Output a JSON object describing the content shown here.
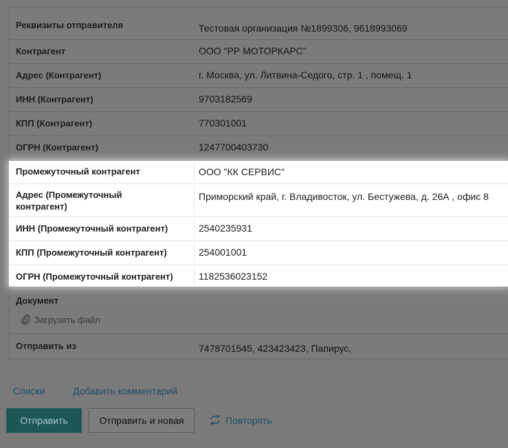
{
  "rows": [
    {
      "label": "Реквизиты отправителя",
      "value": "Тестовая организация №1899306, 9618993069"
    },
    {
      "label": "Контрагент",
      "value": "ООО \"РР МОТОРКАРС\""
    },
    {
      "label": "Адрес (Контрагент)",
      "value": "г. Москва, ул. Литвина-Седого, стр. 1 , помещ. 1"
    },
    {
      "label": "ИНН (Контрагент)",
      "value": "9703182569"
    },
    {
      "label": "КПП (Контрагент)",
      "value": "770301001"
    },
    {
      "label": "ОГРН (Контрагент)",
      "value": "1247700403730"
    },
    {
      "label": "Промежуточный контрагент",
      "value": "ООО \"КК СЕРВИС\""
    },
    {
      "label": "Адрес (Промежуточный контрагент)",
      "value": "Приморский край, г. Владивосток, ул. Бестужева, д. 26А , офис 8"
    },
    {
      "label": "ИНН (Промежуточный контрагент)",
      "value": "2540235931"
    },
    {
      "label": "КПП (Промежуточный контрагент)",
      "value": "254001001"
    },
    {
      "label": "ОГРН (Промежуточный контрагент)",
      "value": "1182536023152"
    }
  ],
  "document": {
    "label": "Документ",
    "upload_label": "Загрузить файл"
  },
  "send_from": {
    "label": "Отправить из",
    "value": "7478701545, 423423423, Папирус,"
  },
  "links": {
    "lists": "Списки",
    "add_comment": "Добавить комментарий"
  },
  "buttons": {
    "send": "Отправить",
    "send_and_new": "Отправить и новая",
    "repeat": "Повторять"
  },
  "colors": {
    "accent": "#1c5755",
    "link": "#1e4f66",
    "overlay": "#7a7a7a"
  },
  "icons": {
    "upload": "paperclip-icon",
    "repeat": "repeat-icon"
  }
}
